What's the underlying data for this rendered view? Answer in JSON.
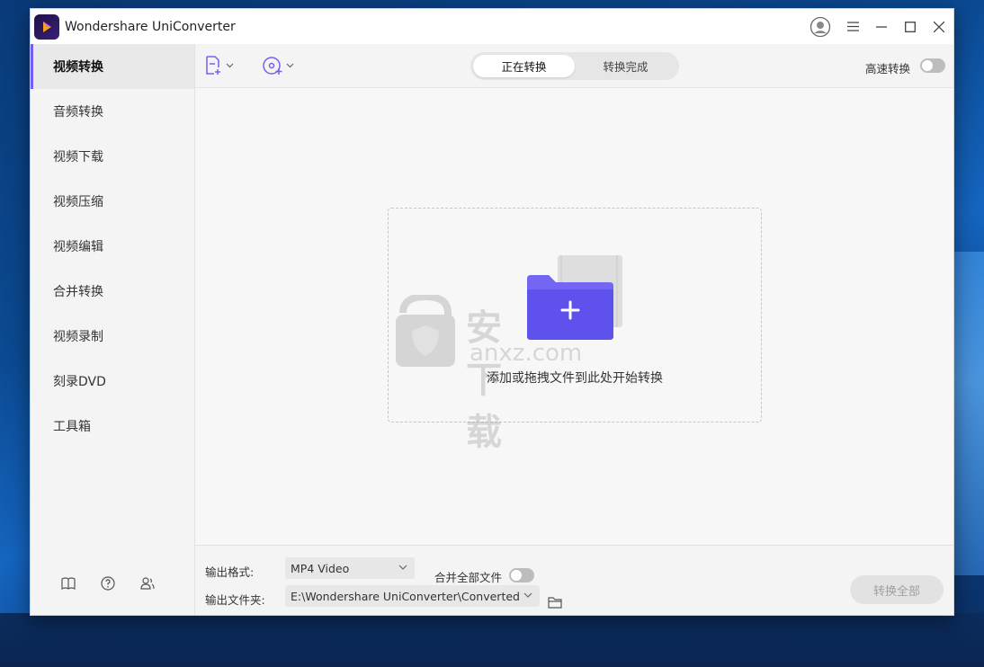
{
  "window": {
    "title": "Wondershare UniConverter",
    "controls": [
      "user-icon",
      "menu-icon",
      "minimize-icon",
      "maximize-icon",
      "close-icon"
    ]
  },
  "sidebar": {
    "items": [
      {
        "label": "视频转换",
        "active": true
      },
      {
        "label": "音频转换"
      },
      {
        "label": "视频下载"
      },
      {
        "label": "视频压缩"
      },
      {
        "label": "视频编辑"
      },
      {
        "label": "合并转换"
      },
      {
        "label": "视频录制"
      },
      {
        "label": "刻录DVD"
      },
      {
        "label": "工具箱"
      }
    ],
    "bottom_icons": [
      "book-icon",
      "help-icon",
      "account-icon"
    ]
  },
  "toolbar": {
    "add_file_icon": "add-file-icon",
    "add_disc_icon": "add-disc-icon",
    "tabs": [
      {
        "label": "正在转换",
        "active": true
      },
      {
        "label": "转换完成"
      }
    ],
    "fast_convert_label": "高速转换",
    "fast_convert_on": false
  },
  "main": {
    "drop_text": "添加或拖拽文件到此处开始转换",
    "watermark_text": "安下载",
    "watermark_sub": "anxz.com"
  },
  "footer": {
    "output_format_label": "输出格式:",
    "output_format_value": "MP4 Video",
    "merge_label": "合并全部文件",
    "merge_on": false,
    "output_folder_label": "输出文件夹:",
    "output_folder_value": "E:\\Wondershare UniConverter\\Converted",
    "convert_all_label": "转换全部"
  },
  "colors": {
    "accent": "#7b5cf0",
    "folder": "#6a5cf0"
  }
}
